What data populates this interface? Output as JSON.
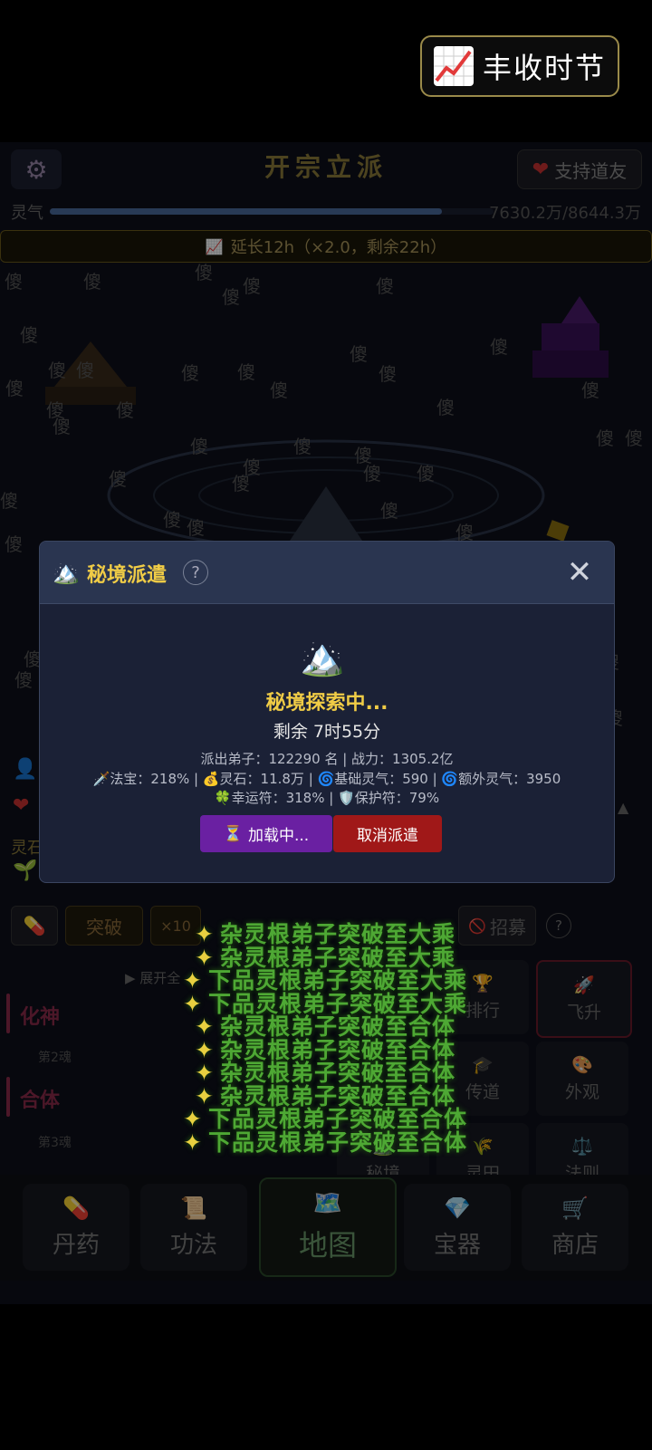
{
  "festival": {
    "label": "丰收时节"
  },
  "header": {
    "title": "开宗立派",
    "support_label": "支持道友"
  },
  "lingqi": {
    "label": "灵气",
    "value_text": "7630.2万/8644.3万",
    "progress": 0.8827
  },
  "extend_banner": {
    "text": "延长12h（×2.0，剩余22h）"
  },
  "rain_glyph": "傻",
  "modal": {
    "title": "秘境派遣",
    "help": "?",
    "close": "✕",
    "status": "秘境探索中...",
    "remaining": "剩余 7时55分",
    "info1": "派出弟子：122290 名 | 战力：1305.2亿",
    "info2": "🗡️法宝：218% | 💰灵石：11.8万 | 🌀基础灵气：590 | 🌀额外灵气：3950",
    "info3": "🍀幸运符：318% | 🛡️保护符：79%",
    "loading_label": "加载中...",
    "cancel_label": "取消派遣"
  },
  "side": {
    "spirit_stone_label": "灵石"
  },
  "actions": {
    "pill_icon": "💊",
    "breakthrough": "突破",
    "times10": "×10",
    "recruit": "招募",
    "help": "?"
  },
  "realms": {
    "expand": "▶ 展开全",
    "items": [
      {
        "name": "化神"
      },
      {
        "layer": "第2魂"
      },
      {
        "name": "合体"
      },
      {
        "layer": "第3魂"
      }
    ]
  },
  "grid": {
    "rank": "排行",
    "ascend": "飞升",
    "preach": "传道",
    "appearance": "外观",
    "secret": "秘境",
    "harvest": "灵田",
    "law": "法则"
  },
  "nav": {
    "items": [
      {
        "label": "丹药",
        "icon": "💊"
      },
      {
        "label": "功法",
        "icon": "📜"
      },
      {
        "label": "地图",
        "icon": "🗺️"
      },
      {
        "label": "宝器",
        "icon": "💎"
      },
      {
        "label": "商店",
        "icon": "🛒"
      }
    ]
  },
  "notifications": [
    "杂灵根弟子突破至大乘",
    "杂灵根弟子突破至大乘",
    "下品灵根弟子突破至大乘",
    "下品灵根弟子突破至大乘",
    "杂灵根弟子突破至合体",
    "杂灵根弟子突破至合体",
    "杂灵根弟子突破至合体",
    "杂灵根弟子突破至合体",
    "下品灵根弟子突破至合体",
    "下品灵根弟子突破至合体"
  ],
  "colors": {
    "gold": "#f0cc46",
    "purple": "#6a20a2",
    "red": "#a01818",
    "green": "#4ea834"
  }
}
